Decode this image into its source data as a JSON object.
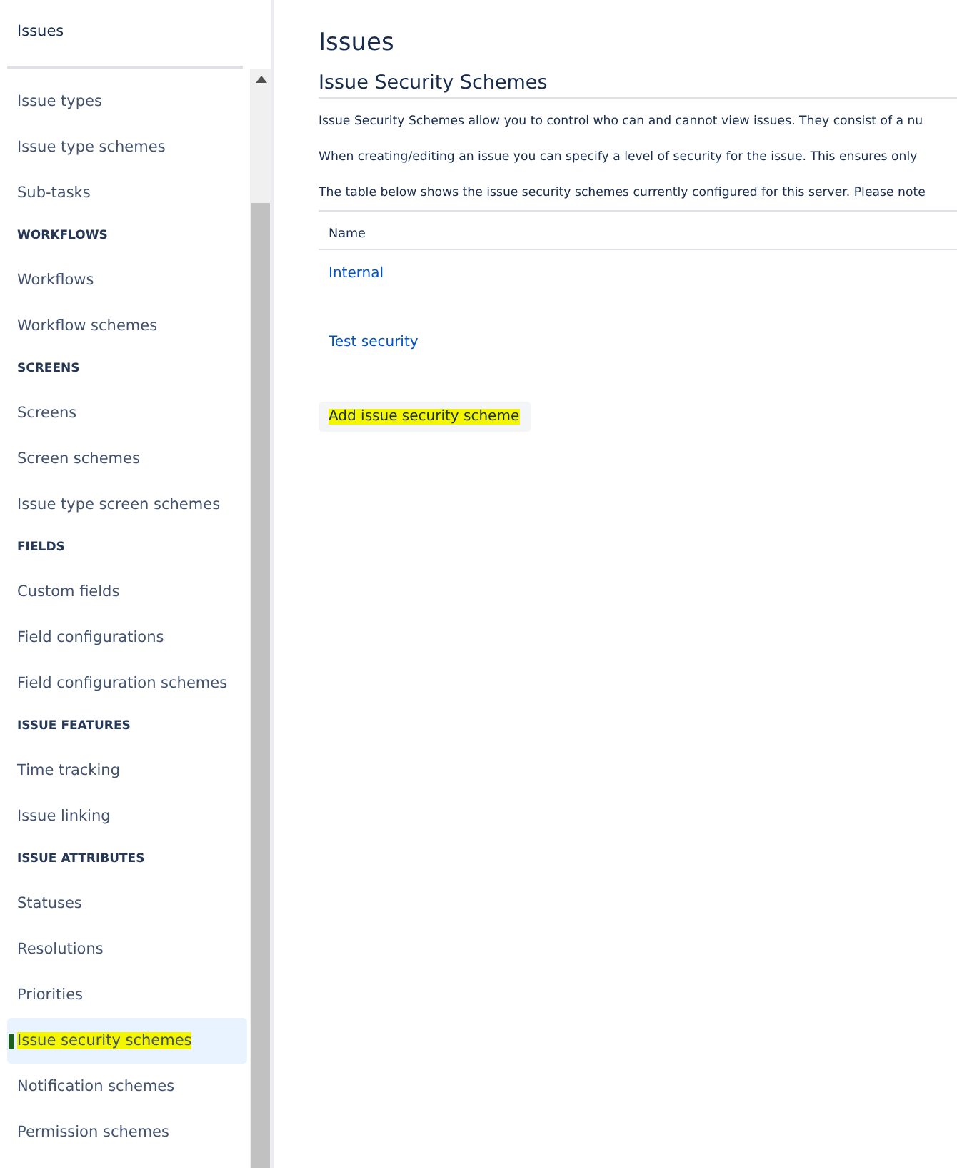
{
  "sidebar": {
    "title": "Issues",
    "sections": [
      {
        "items": [
          {
            "label": "Issue types",
            "selected": false,
            "highlighted": false
          },
          {
            "label": "Issue type schemes",
            "selected": false,
            "highlighted": false
          },
          {
            "label": "Sub-tasks",
            "selected": false,
            "highlighted": false
          }
        ]
      },
      {
        "heading": "WORKFLOWS",
        "items": [
          {
            "label": "Workflows",
            "selected": false,
            "highlighted": false
          },
          {
            "label": "Workflow schemes",
            "selected": false,
            "highlighted": false
          }
        ]
      },
      {
        "heading": "SCREENS",
        "items": [
          {
            "label": "Screens",
            "selected": false,
            "highlighted": false
          },
          {
            "label": "Screen schemes",
            "selected": false,
            "highlighted": false
          },
          {
            "label": "Issue type screen schemes",
            "selected": false,
            "highlighted": false
          }
        ]
      },
      {
        "heading": "FIELDS",
        "items": [
          {
            "label": "Custom fields",
            "selected": false,
            "highlighted": false
          },
          {
            "label": "Field configurations",
            "selected": false,
            "highlighted": false
          },
          {
            "label": "Field configuration schemes",
            "selected": false,
            "highlighted": false
          }
        ]
      },
      {
        "heading": "ISSUE FEATURES",
        "items": [
          {
            "label": "Time tracking",
            "selected": false,
            "highlighted": false
          },
          {
            "label": "Issue linking",
            "selected": false,
            "highlighted": false
          }
        ]
      },
      {
        "heading": "ISSUE ATTRIBUTES",
        "items": [
          {
            "label": "Statuses",
            "selected": false,
            "highlighted": false
          },
          {
            "label": "Resolutions",
            "selected": false,
            "highlighted": false
          },
          {
            "label": "Priorities",
            "selected": false,
            "highlighted": false
          },
          {
            "label": "Issue security schemes",
            "selected": true,
            "highlighted": true
          },
          {
            "label": "Notification schemes",
            "selected": false,
            "highlighted": false
          },
          {
            "label": "Permission schemes",
            "selected": false,
            "highlighted": false
          }
        ]
      }
    ]
  },
  "page": {
    "title": "Issues",
    "subtitle": "Issue Security Schemes",
    "paragraphs": [
      "Issue Security Schemes allow you to control who can and cannot view issues. They consist of a nu",
      "When creating/editing an issue you can specify a level of security for the issue. This ensures only",
      "The table below shows the issue security schemes currently configured for this server. Please note"
    ],
    "table": {
      "columns": [
        "Name"
      ],
      "rows": [
        [
          "Internal"
        ],
        [
          "Test security"
        ]
      ]
    },
    "add_button": {
      "label": "Add issue security scheme",
      "highlighted": true
    }
  }
}
